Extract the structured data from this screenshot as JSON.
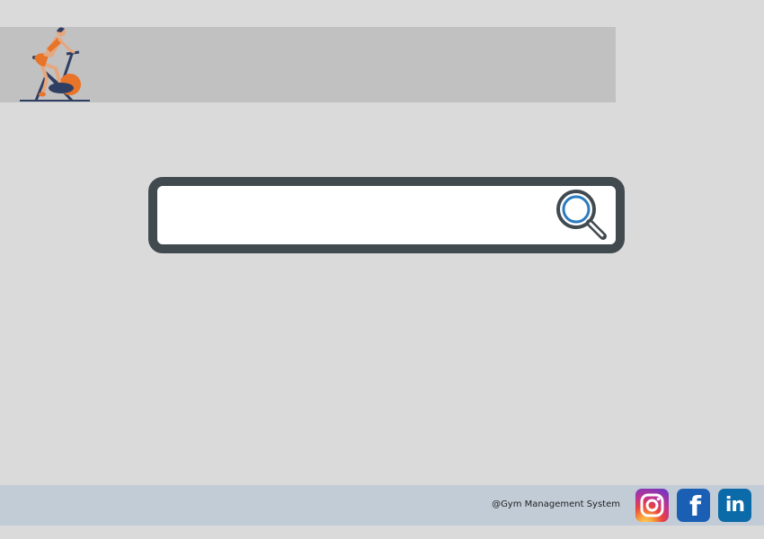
{
  "header": {
    "logo_icon": "exercise-bike-icon",
    "logo_colors": {
      "accent": "#e8742a",
      "frame": "#2f3e63",
      "skin": "#e6a77f"
    }
  },
  "search": {
    "value": "",
    "placeholder": "",
    "button_icon": "magnifier-search-icon",
    "border_color": "#414a4f",
    "icon_color": "#2b7bbf"
  },
  "footer": {
    "copyright": "@Gym Management System",
    "background": "#c2ccd6",
    "social": [
      {
        "name": "Instagram",
        "icon": "instagram-icon"
      },
      {
        "name": "Facebook",
        "icon": "facebook-icon",
        "glyph": "f"
      },
      {
        "name": "LinkedIn",
        "icon": "linkedin-icon",
        "glyph": "in"
      }
    ]
  }
}
